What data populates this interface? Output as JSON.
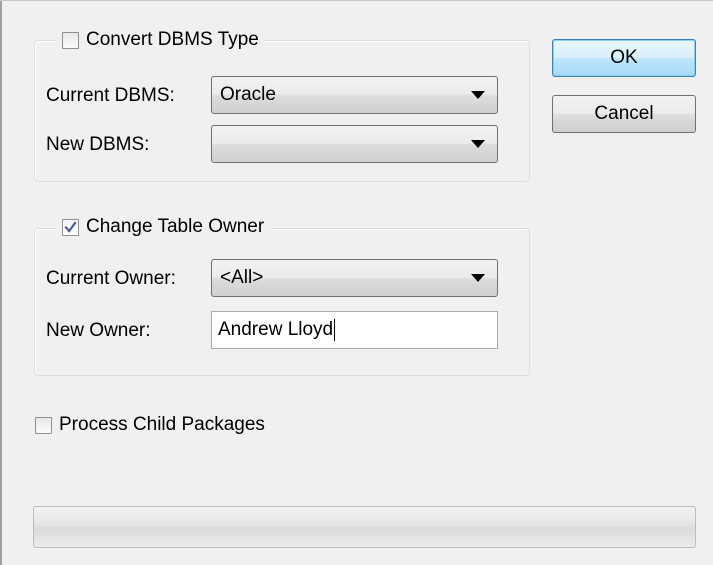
{
  "convert_dbms": {
    "checkbox_label": "Convert DBMS Type",
    "checked": false,
    "current_dbms_label": "Current DBMS:",
    "current_dbms_value": "Oracle",
    "new_dbms_label": "New DBMS:",
    "new_dbms_value": ""
  },
  "change_owner": {
    "checkbox_label": "Change Table Owner",
    "checked": true,
    "current_owner_label": "Current Owner:",
    "current_owner_value": "<All>",
    "new_owner_label": "New Owner:",
    "new_owner_value": "Andrew Lloyd"
  },
  "process_child": {
    "checkbox_label": "Process Child Packages",
    "checked": false
  },
  "buttons": {
    "ok_label": "OK",
    "cancel_label": "Cancel"
  },
  "progress": {
    "value": 0
  },
  "colors": {
    "dialog_bg": "#f0f0f0",
    "default_button": "#bee6fd",
    "check_mark": "#4a5f97"
  },
  "icons": {
    "dropdown": "chevron-down-icon",
    "check": "check-icon"
  }
}
